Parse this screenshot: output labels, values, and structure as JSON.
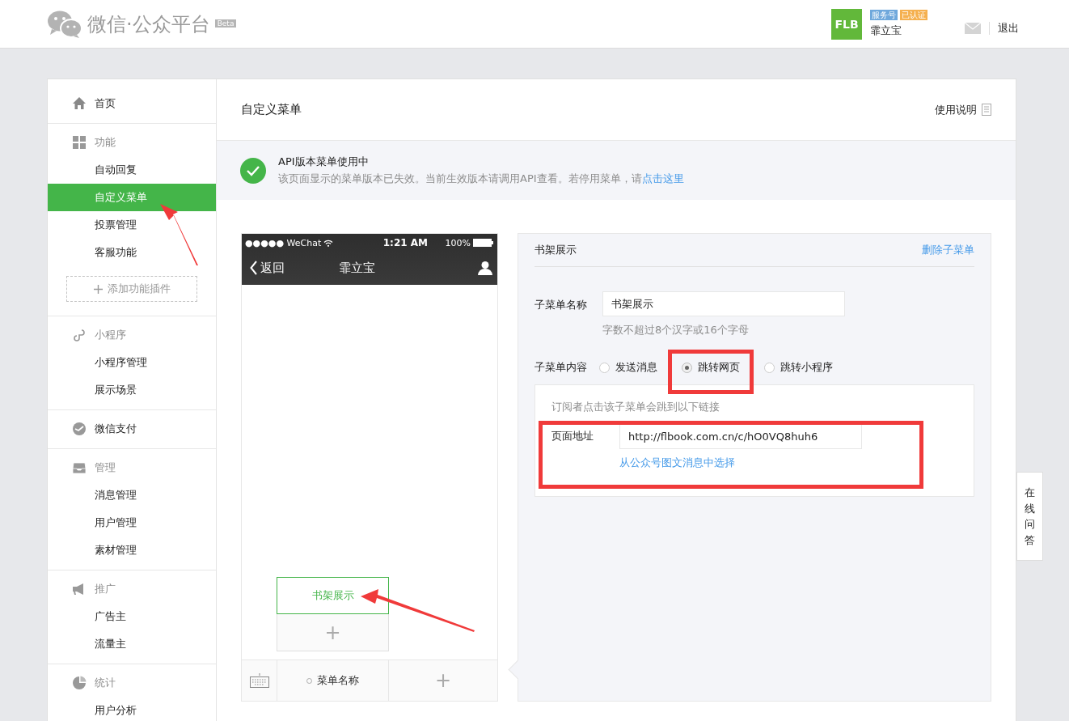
{
  "header": {
    "logo_text": "微信·公众平台",
    "beta": "Beta",
    "avatar_text": "FLB",
    "badges": [
      {
        "label": "服务号",
        "color": "#6fa8dc"
      },
      {
        "label": "已认证",
        "color": "#f5b04f"
      }
    ],
    "account": "霏立宝",
    "logout": "退出"
  },
  "sidebar": {
    "sections": [
      {
        "title": "首页"
      },
      {
        "title": "功能",
        "items": [
          {
            "label": "自动回复",
            "selected": false
          },
          {
            "label": "自定义菜单",
            "selected": true
          },
          {
            "label": "投票管理",
            "selected": false
          },
          {
            "label": "客服功能",
            "selected": false
          }
        ],
        "action": "添加功能插件"
      },
      {
        "title": "小程序",
        "items": [
          {
            "label": "小程序管理",
            "selected": false
          },
          {
            "label": "展示场景",
            "selected": false
          }
        ]
      },
      {
        "title": "微信支付"
      },
      {
        "title": "管理",
        "items": [
          {
            "label": "消息管理",
            "selected": false
          },
          {
            "label": "用户管理",
            "selected": false
          },
          {
            "label": "素材管理",
            "selected": false
          }
        ]
      },
      {
        "title": "推广",
        "items": [
          {
            "label": "广告主",
            "selected": false
          },
          {
            "label": "流量主",
            "selected": false
          }
        ]
      },
      {
        "title": "统计",
        "items": [
          {
            "label": "用户分析",
            "selected": false
          }
        ]
      }
    ]
  },
  "page_title": "自定义菜单",
  "help": "使用说明",
  "notice": {
    "title": "API版本菜单使用中",
    "text": "该页面显示的菜单版本已失效。当前生效版本请调用API查看。若停用菜单，请",
    "link": "点击这里"
  },
  "phone": {
    "status": {
      "carrier": "●●●●● WeChat",
      "time": "1:21 AM",
      "battery": "100%"
    },
    "nav": {
      "back": "返回",
      "title": "霏立宝"
    },
    "submenu": [
      {
        "label": "书架展示",
        "selected": true
      }
    ],
    "submenu_add": "+",
    "menus": [
      {
        "label": "菜单名称"
      }
    ],
    "menu_add": "+"
  },
  "editor": {
    "title": "书架展示",
    "delete": "删除子菜单",
    "name_label": "子菜单名称",
    "name_value": "书架展示",
    "hint": "字数不超过8个汉字或16个字母",
    "content_label": "子菜单内容",
    "options": [
      {
        "label": "发送消息",
        "selected": false
      },
      {
        "label": "跳转网页",
        "selected": true
      },
      {
        "label": "跳转小程序",
        "selected": false
      }
    ],
    "link_panel": {
      "description": "订阅者点击该子菜单会跳到以下链接",
      "url_label": "页面地址",
      "url_value": "http://flbook.com.cn/c/hO0VQ8huh6",
      "pick": "从公众号图文消息中选择"
    }
  },
  "float_help": "在线问答"
}
